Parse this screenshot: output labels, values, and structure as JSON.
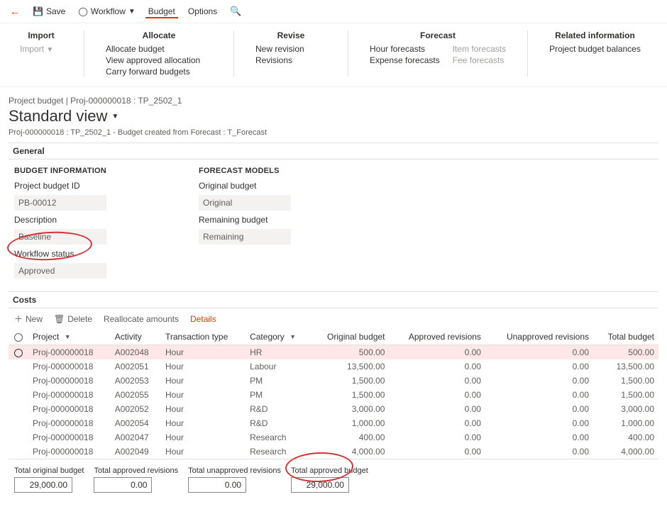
{
  "toolbar": {
    "save_label": "Save",
    "workflow_label": "Workflow",
    "budget_label": "Budget",
    "options_label": "Options"
  },
  "groups": {
    "import": {
      "title": "Import",
      "items": [
        "Import"
      ]
    },
    "allocate": {
      "title": "Allocate",
      "items": [
        "Allocate budget",
        "View approved allocation",
        "Carry forward budgets"
      ]
    },
    "revise": {
      "title": "Revise",
      "items": [
        "New revision",
        "Revisions"
      ]
    },
    "forecast": {
      "title": "Forecast",
      "col1": [
        "Hour forecasts",
        "Expense forecasts"
      ],
      "col2": [
        "Item forecasts",
        "Fee forecasts"
      ]
    },
    "related": {
      "title": "Related information",
      "items": [
        "Project budget balances"
      ]
    }
  },
  "breadcrumb": "Project budget  |  Proj-000000018 : TP_2502_1",
  "page_title": "Standard view",
  "subtitle": "Proj-000000018 : TP_2502_1 - Budget created from Forecast : T_Forecast",
  "general": {
    "head": "General",
    "budget_info_head": "BUDGET INFORMATION",
    "project_budget_id_label": "Project budget ID",
    "project_budget_id": "PB-00012",
    "description_label": "Description",
    "description": "Baseline",
    "workflow_status_label": "Workflow status",
    "workflow_status": "Approved",
    "forecast_models_head": "FORECAST MODELS",
    "original_budget_label": "Original budget",
    "original_budget": "Original",
    "remaining_budget_label": "Remaining budget",
    "remaining_budget": "Remaining"
  },
  "costs": {
    "head": "Costs",
    "new_label": "New",
    "delete_label": "Delete",
    "reallocate_label": "Reallocate amounts",
    "details_label": "Details",
    "headers": {
      "project": "Project",
      "activity": "Activity",
      "txn_type": "Transaction type",
      "category": "Category",
      "orig": "Original budget",
      "appr_rev": "Approved revisions",
      "unappr_rev": "Unapproved revisions",
      "total": "Total budget"
    },
    "rows": [
      {
        "project": "Proj-000000018",
        "activity": "A002048",
        "txn": "Hour",
        "cat": "HR",
        "orig": "500.00",
        "appr": "0.00",
        "unappr": "0.00",
        "total": "500.00"
      },
      {
        "project": "Proj-000000018",
        "activity": "A002051",
        "txn": "Hour",
        "cat": "Labour",
        "orig": "13,500.00",
        "appr": "0.00",
        "unappr": "0.00",
        "total": "13,500.00"
      },
      {
        "project": "Proj-000000018",
        "activity": "A002053",
        "txn": "Hour",
        "cat": "PM",
        "orig": "1,500.00",
        "appr": "0.00",
        "unappr": "0.00",
        "total": "1,500.00"
      },
      {
        "project": "Proj-000000018",
        "activity": "A002055",
        "txn": "Hour",
        "cat": "PM",
        "orig": "1,500.00",
        "appr": "0.00",
        "unappr": "0.00",
        "total": "1,500.00"
      },
      {
        "project": "Proj-000000018",
        "activity": "A002052",
        "txn": "Hour",
        "cat": "R&D",
        "orig": "3,000.00",
        "appr": "0.00",
        "unappr": "0.00",
        "total": "3,000.00"
      },
      {
        "project": "Proj-000000018",
        "activity": "A002054",
        "txn": "Hour",
        "cat": "R&D",
        "orig": "1,000.00",
        "appr": "0.00",
        "unappr": "0.00",
        "total": "1,000.00"
      },
      {
        "project": "Proj-000000018",
        "activity": "A002047",
        "txn": "Hour",
        "cat": "Research",
        "orig": "400.00",
        "appr": "0.00",
        "unappr": "0.00",
        "total": "400.00"
      },
      {
        "project": "Proj-000000018",
        "activity": "A002049",
        "txn": "Hour",
        "cat": "Research",
        "orig": "4,000.00",
        "appr": "0.00",
        "unappr": "0.00",
        "total": "4,000.00"
      }
    ],
    "totals": {
      "orig_label": "Total original budget",
      "orig": "29,000.00",
      "appr_rev_label": "Total approved revisions",
      "appr_rev": "0.00",
      "unappr_rev_label": "Total unapproved revisions",
      "unappr_rev": "0.00",
      "appr_budget_label": "Total approved budget",
      "appr_budget": "29,000.00"
    }
  }
}
